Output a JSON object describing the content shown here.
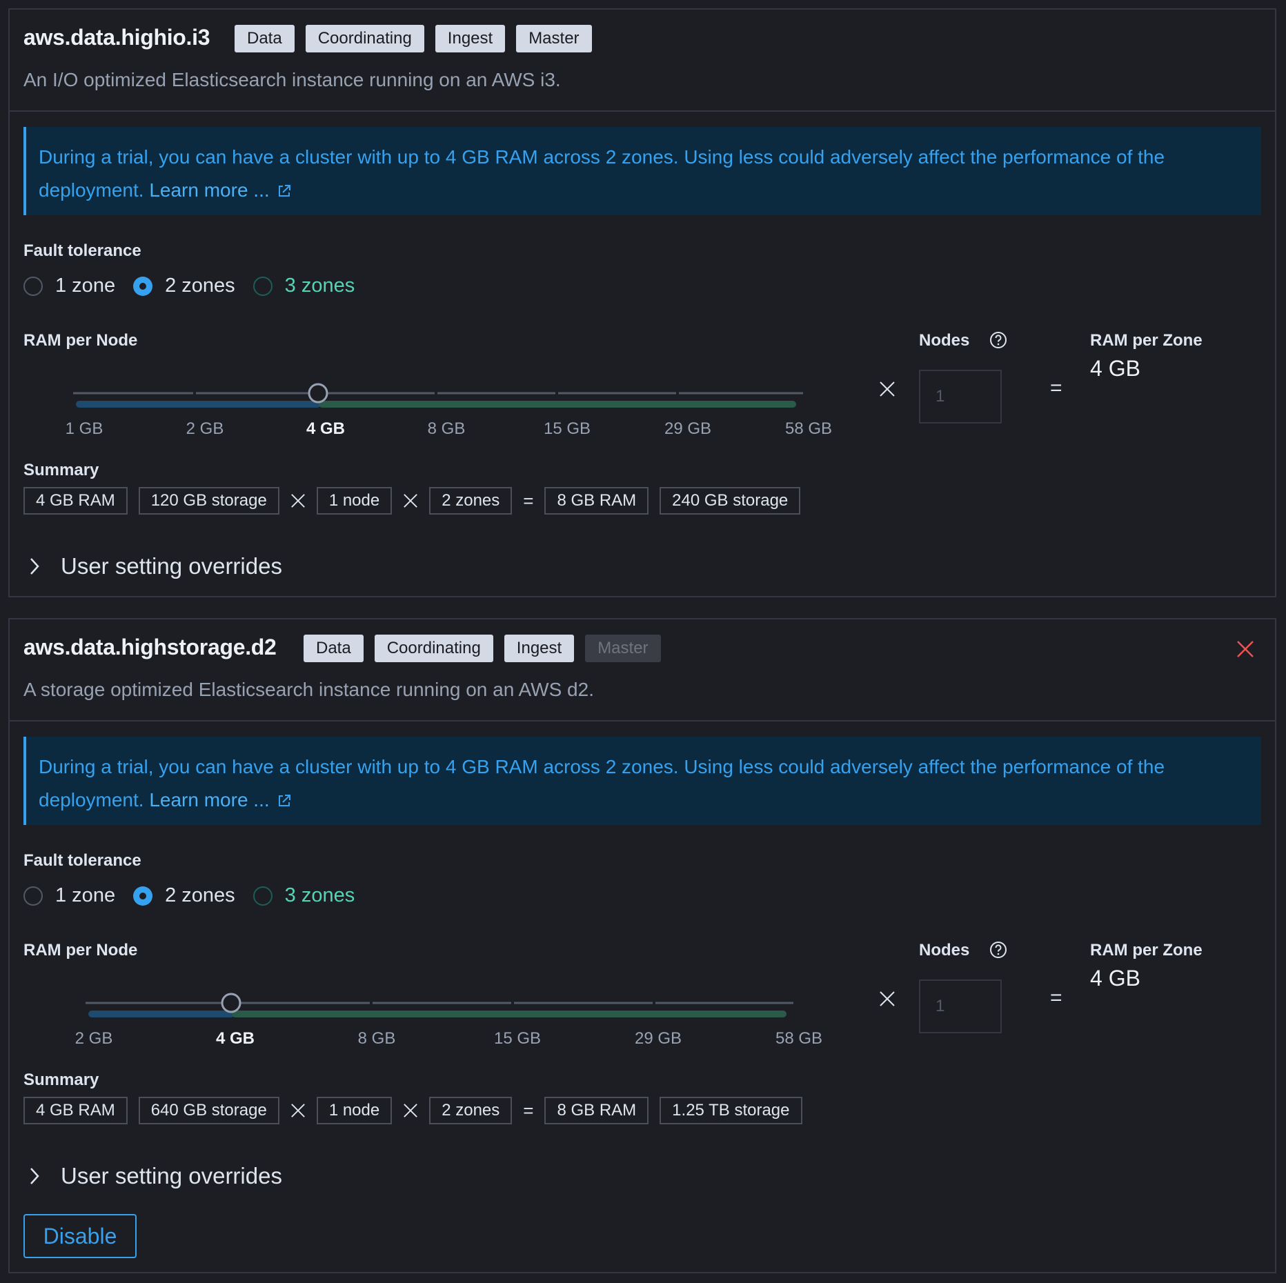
{
  "panels": [
    {
      "title": "aws.data.highio.i3",
      "badges": [
        "Data",
        "Coordinating",
        "Ingest",
        "Master"
      ],
      "description": "An I/O optimized Elasticsearch instance running on an AWS i3.",
      "callout_text": "During a trial, you can have a cluster with up to 4 GB RAM across 2 zones. Using less could adversely affect the performance of the deployment.",
      "callout_link": "Learn more ...",
      "fault_tolerance_label": "Fault tolerance",
      "zones": [
        "1 zone",
        "2 zones",
        "3 zones"
      ],
      "selected_zone": "2 zones",
      "ram_label": "RAM per Node",
      "ticks": [
        "1 GB",
        "2 GB",
        "4 GB",
        "8 GB",
        "15 GB",
        "29 GB",
        "58 GB"
      ],
      "selected_ram": "4 GB",
      "nodes_label": "Nodes",
      "nodes_value": "1",
      "ram_zone_label": "RAM per Zone",
      "ram_zone_value": "4 GB",
      "summary_label": "Summary",
      "summary": {
        "ram": "4 GB RAM",
        "storage": "120 GB storage",
        "nodes": "1 node",
        "zones": "2 zones",
        "total_ram": "8 GB RAM",
        "total_storage": "240 GB storage"
      },
      "overrides_label": "User setting overrides"
    },
    {
      "title": "aws.data.highstorage.d2",
      "badges": [
        "Data",
        "Coordinating",
        "Ingest",
        "Master"
      ],
      "description": "A storage optimized Elasticsearch instance running on an AWS d2.",
      "callout_text": "During a trial, you can have a cluster with up to 4 GB RAM across 2 zones. Using less could adversely affect the performance of the deployment.",
      "callout_link": "Learn more ...",
      "fault_tolerance_label": "Fault tolerance",
      "zones": [
        "1 zone",
        "2 zones",
        "3 zones"
      ],
      "selected_zone": "2 zones",
      "ram_label": "RAM per Node",
      "ticks": [
        "2 GB",
        "4 GB",
        "8 GB",
        "15 GB",
        "29 GB",
        "58 GB"
      ],
      "selected_ram": "4 GB",
      "nodes_label": "Nodes",
      "nodes_value": "1",
      "ram_zone_label": "RAM per Zone",
      "ram_zone_value": "4 GB",
      "summary_label": "Summary",
      "summary": {
        "ram": "4 GB RAM",
        "storage": "640 GB storage",
        "nodes": "1 node",
        "zones": "2 zones",
        "total_ram": "8 GB RAM",
        "total_storage": "1.25 TB storage"
      },
      "overrides_label": "User setting overrides",
      "disable_label": "Disable"
    }
  ],
  "colors": {
    "accent": "#36a2ef",
    "callout_bg": "#0b2a40",
    "teal": "#54d6b4",
    "track_low": "#1e4a6e",
    "track_high": "#2a5a48",
    "danger": "#f0524f"
  }
}
